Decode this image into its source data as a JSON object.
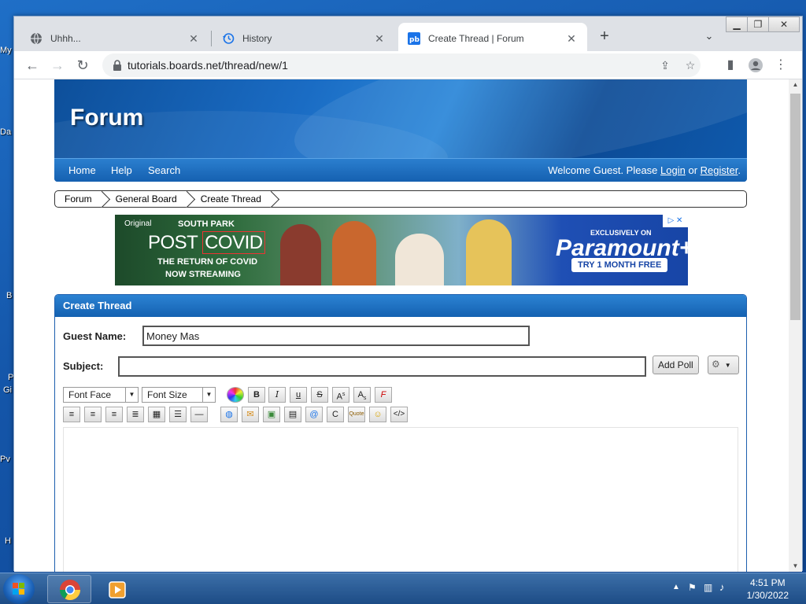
{
  "desktop": {
    "labels": [
      "My",
      "Da",
      "B",
      "P",
      "Gi",
      "Pv",
      "H"
    ]
  },
  "browser": {
    "tabs": [
      {
        "title": "Uhhh...",
        "close": "✕"
      },
      {
        "title": "History",
        "close": "✕"
      },
      {
        "title": "Create Thread | Forum",
        "close": "✕"
      }
    ],
    "new_tab": "+",
    "url": "tutorials.boards.net/thread/new/1"
  },
  "forum": {
    "logo": "Forum",
    "nav": [
      "Home",
      "Help",
      "Search"
    ],
    "welcome_prefix": "Welcome Guest. Please",
    "login": "Login",
    "or": "or",
    "register": "Register",
    "period": ".",
    "breadcrumbs": [
      "Forum",
      "General Board",
      "Create Thread"
    ]
  },
  "ad": {
    "original": "Original",
    "show": "SOUTH PARK",
    "headline_a": "POST",
    "headline_b": "COVID",
    "sub1": "THE RETURN OF COVID",
    "sub2": "NOW STREAMING",
    "exclusive": "EXCLUSIVELY ON",
    "brand": "Paramount+",
    "cta": "TRY 1 MONTH FREE"
  },
  "form": {
    "panel_title": "Create Thread",
    "guest_label": "Guest Name:",
    "guest_value": "Money Mas",
    "subject_label": "Subject:",
    "subject_value": "",
    "add_poll": "Add Poll",
    "font_face": "Font Face",
    "font_size": "Font Size"
  },
  "taskbar": {
    "time": "4:51 PM",
    "date": "1/30/2022"
  }
}
